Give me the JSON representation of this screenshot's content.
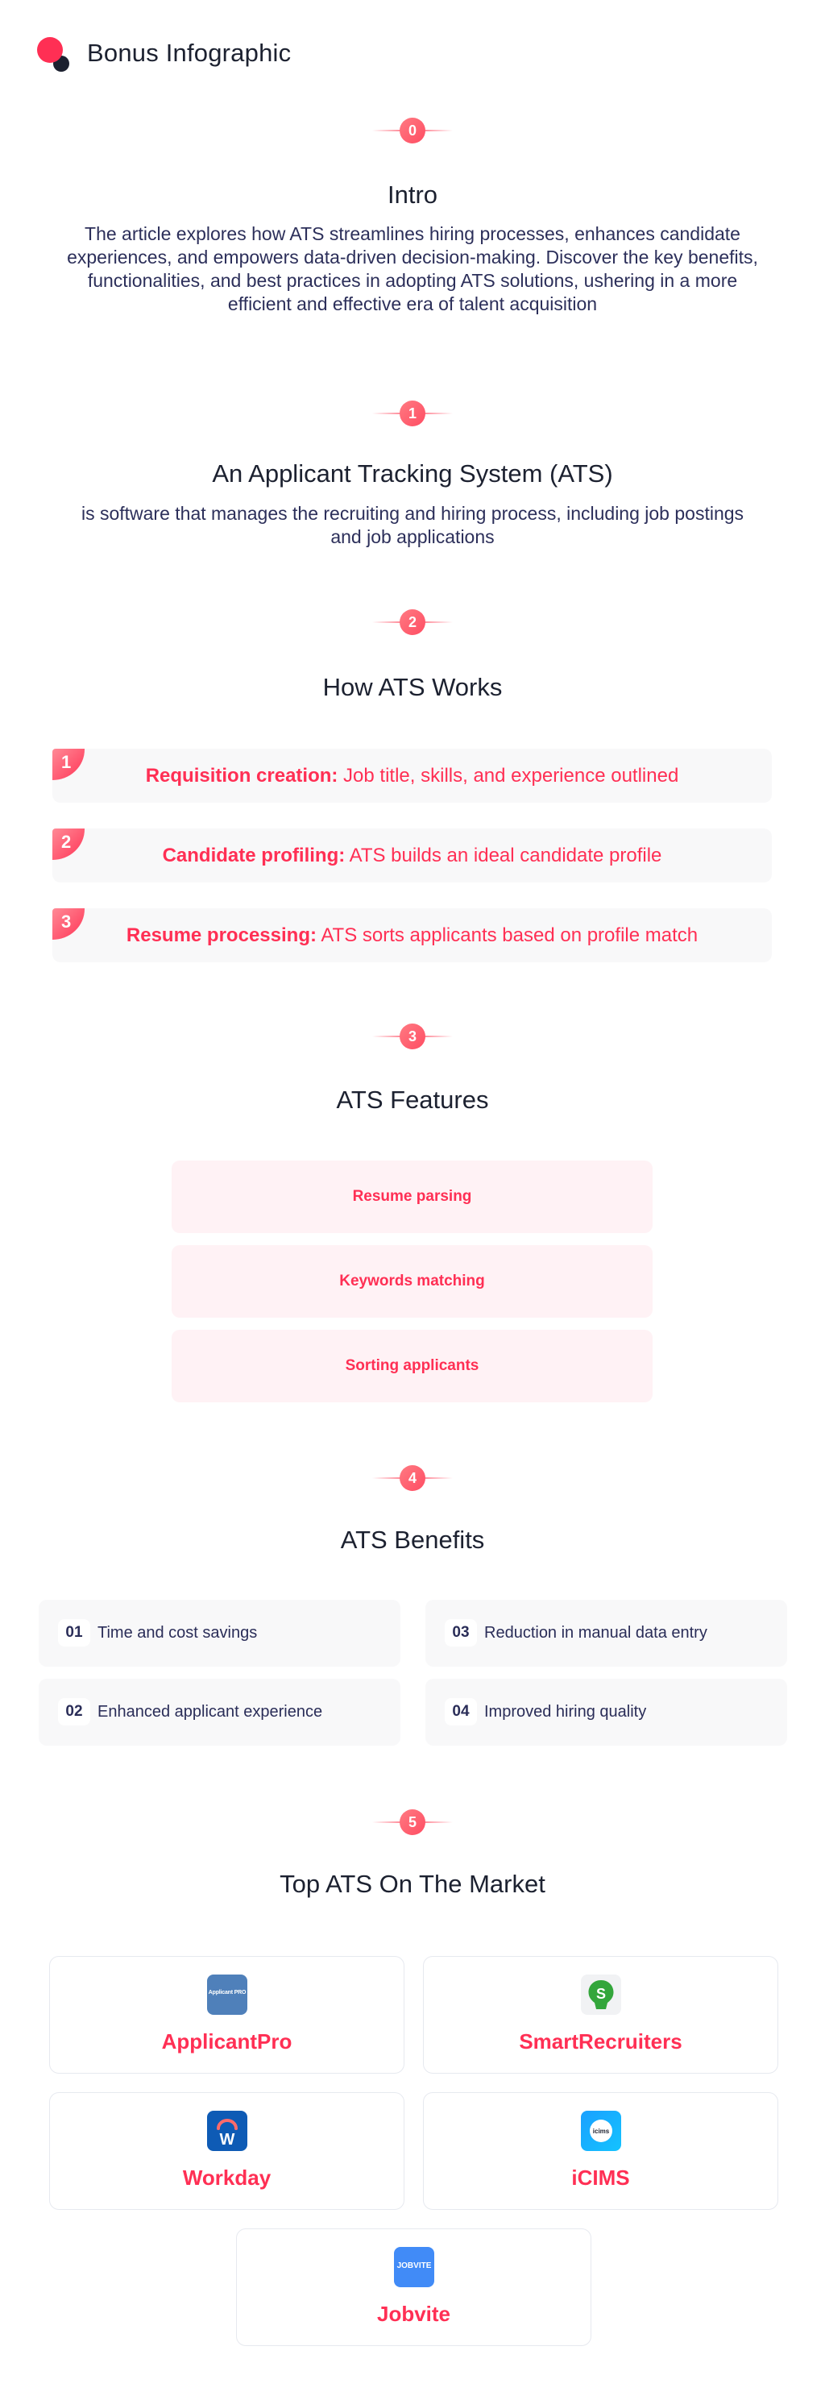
{
  "header": {
    "title": "Bonus Infographic",
    "logo_icon": "two-dots-logo-icon"
  },
  "colors": {
    "accent": "#ff2f54",
    "dark": "#1c2130",
    "text_navy": "#2c2f5a",
    "step_bg": "#f8f8f9",
    "feature_bg": "#fff2f5"
  },
  "sections": {
    "intro": {
      "number": "0",
      "title": "Intro",
      "body": "The article explores how ATS streamlines hiring processes, enhances candidate experiences, and empowers data-driven decision-making. Discover the key benefits, functionalities, and best practices in adopting ATS solutions, ushering in a more efficient and effective era of talent acquisition"
    },
    "definition": {
      "number": "1",
      "title": "An Applicant Tracking System (ATS)",
      "body": "is software that manages the recruiting and hiring process, including job postings and job applications"
    },
    "how_it_works": {
      "number": "2",
      "title": "How ATS Works",
      "steps": [
        {
          "num": "1",
          "label": "Requisition creation:",
          "text": " Job title, skills, and experience outlined"
        },
        {
          "num": "2",
          "label": "Candidate profiling:",
          "text": " ATS builds an ideal candidate profile"
        },
        {
          "num": "3",
          "label": "Resume processing:",
          "text": " ATS sorts applicants based on profile match"
        }
      ]
    },
    "features": {
      "number": "3",
      "title": "ATS Features",
      "items": [
        "Resume parsing",
        "Keywords matching",
        "Sorting applicants"
      ]
    },
    "benefits": {
      "number": "4",
      "title": "ATS Benefits",
      "items": [
        {
          "num": "01",
          "text": "Time and cost savings"
        },
        {
          "num": "02",
          "text": "Enhanced applicant experience"
        },
        {
          "num": "03",
          "text": "Reduction in manual data entry"
        },
        {
          "num": "04",
          "text": "Improved hiring quality"
        }
      ]
    },
    "top_ats": {
      "number": "5",
      "title": "Top ATS On The Market",
      "vendors": [
        {
          "name": "ApplicantPro",
          "logo_text": "Applicant PRO",
          "icon": "applicantpro-logo-icon"
        },
        {
          "name": "SmartRecruiters",
          "logo_text": "S",
          "icon": "smartrecruiters-logo-icon"
        },
        {
          "name": "Workday",
          "logo_text": "W",
          "icon": "workday-logo-icon"
        },
        {
          "name": "iCIMS",
          "logo_text": "icims",
          "icon": "icims-logo-icon"
        },
        {
          "name": "Jobvite",
          "logo_text": "JOBVITE",
          "icon": "jobvite-logo-icon"
        }
      ]
    }
  }
}
